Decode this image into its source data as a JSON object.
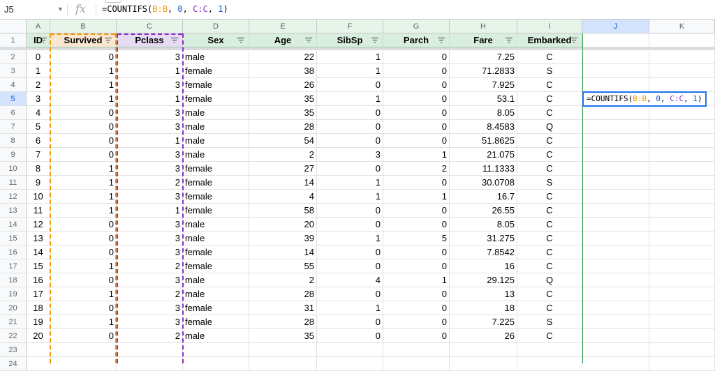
{
  "formula_bar": {
    "name_box": "J5",
    "fx_label": "fx",
    "formula_parts": [
      {
        "t": "=COUNTIFS(",
        "c": "plain"
      },
      {
        "t": "B:B",
        "c": "orange"
      },
      {
        "t": ", ",
        "c": "plain"
      },
      {
        "t": "0",
        "c": "num"
      },
      {
        "t": ", ",
        "c": "plain"
      },
      {
        "t": "C:C",
        "c": "purple"
      },
      {
        "t": ", ",
        "c": "plain"
      },
      {
        "t": "1",
        "c": "num"
      },
      {
        "t": ")",
        "c": "plain"
      }
    ]
  },
  "columns": [
    "A",
    "B",
    "C",
    "D",
    "E",
    "F",
    "G",
    "H",
    "I",
    "J",
    "K"
  ],
  "headers": [
    "ID",
    "Survived",
    "Pclass",
    "Sex",
    "Age",
    "SibSp",
    "Parch",
    "Fare",
    "Embarked"
  ],
  "rows": [
    [
      "0",
      "0",
      "3",
      "male",
      "22",
      "1",
      "0",
      "7.25",
      "C"
    ],
    [
      "1",
      "1",
      "1",
      "female",
      "38",
      "1",
      "0",
      "71.2833",
      "S"
    ],
    [
      "2",
      "1",
      "3",
      "female",
      "26",
      "0",
      "0",
      "7.925",
      "C"
    ],
    [
      "3",
      "1",
      "1",
      "female",
      "35",
      "1",
      "0",
      "53.1",
      "C"
    ],
    [
      "4",
      "0",
      "3",
      "male",
      "35",
      "0",
      "0",
      "8.05",
      "C"
    ],
    [
      "5",
      "0",
      "3",
      "male",
      "28",
      "0",
      "0",
      "8.4583",
      "Q"
    ],
    [
      "6",
      "0",
      "1",
      "male",
      "54",
      "0",
      "0",
      "51.8625",
      "C"
    ],
    [
      "7",
      "0",
      "3",
      "male",
      "2",
      "3",
      "1",
      "21.075",
      "C"
    ],
    [
      "8",
      "1",
      "3",
      "female",
      "27",
      "0",
      "2",
      "11.1333",
      "C"
    ],
    [
      "9",
      "1",
      "2",
      "female",
      "14",
      "1",
      "0",
      "30.0708",
      "S"
    ],
    [
      "10",
      "1",
      "3",
      "female",
      "4",
      "1",
      "1",
      "16.7",
      "C"
    ],
    [
      "11",
      "1",
      "1",
      "female",
      "58",
      "0",
      "0",
      "26.55",
      "C"
    ],
    [
      "12",
      "0",
      "3",
      "male",
      "20",
      "0",
      "0",
      "8.05",
      "C"
    ],
    [
      "13",
      "0",
      "3",
      "male",
      "39",
      "1",
      "5",
      "31.275",
      "C"
    ],
    [
      "14",
      "0",
      "3",
      "female",
      "14",
      "0",
      "0",
      "7.8542",
      "C"
    ],
    [
      "15",
      "1",
      "2",
      "female",
      "55",
      "0",
      "0",
      "16",
      "C"
    ],
    [
      "16",
      "0",
      "3",
      "male",
      "2",
      "4",
      "1",
      "29.125",
      "Q"
    ],
    [
      "17",
      "1",
      "2",
      "male",
      "28",
      "0",
      "0",
      "13",
      "C"
    ],
    [
      "18",
      "0",
      "3",
      "female",
      "31",
      "1",
      "0",
      "18",
      "C"
    ],
    [
      "19",
      "1",
      "3",
      "female",
      "28",
      "0",
      "0",
      "7.225",
      "S"
    ],
    [
      "20",
      "0",
      "2",
      "male",
      "35",
      "0",
      "0",
      "26",
      "C"
    ]
  ],
  "row_numbers": [
    "1",
    "2",
    "3",
    "4",
    "5",
    "6",
    "7",
    "8",
    "9",
    "10",
    "11",
    "12",
    "13",
    "14",
    "15",
    "16",
    "17",
    "18",
    "19",
    "20",
    "21",
    "22",
    "23",
    "24"
  ],
  "active_cell": {
    "ref": "J5"
  },
  "colors": {
    "orange": "#f29900",
    "purple": "#8430ce",
    "number": "#1155cc",
    "header_green": "#d9eede",
    "selection_blue": "#1a73e8"
  }
}
